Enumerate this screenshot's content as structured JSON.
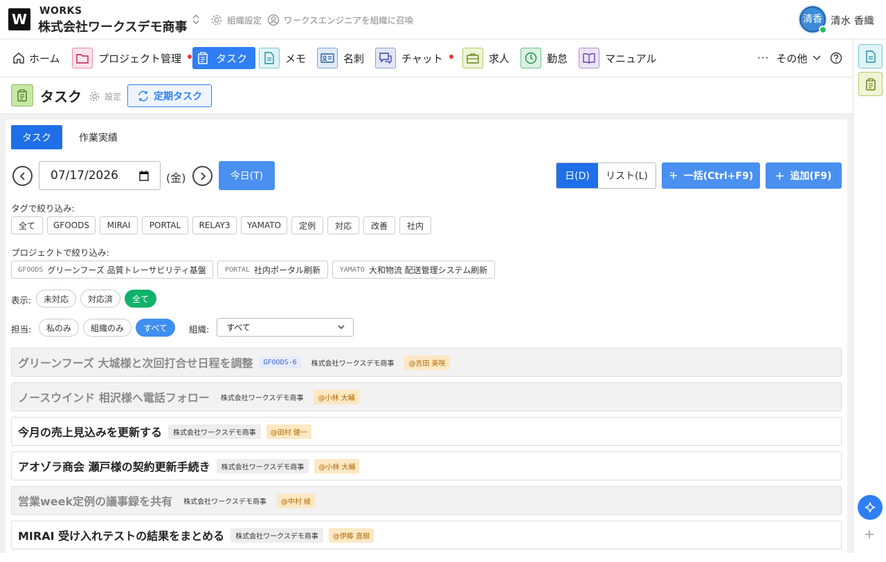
{
  "header": {
    "logo": "W",
    "brand": "WORKS",
    "org_name": "株式会社ワークスデモ商事",
    "org_settings": "組織設定",
    "invite": "ワークスエンジニアを組織に召喚",
    "avatar_text": "清香",
    "user_name": "清水 香織"
  },
  "nav": {
    "items": [
      {
        "label": "ホーム",
        "icon": "home-icon"
      },
      {
        "label": "プロジェクト管理",
        "icon": "folder-icon",
        "dot": true
      },
      {
        "label": "タスク",
        "icon": "clipboard-icon",
        "active": true
      },
      {
        "label": "メモ",
        "icon": "memo-icon"
      },
      {
        "label": "名刺",
        "icon": "business-card-icon"
      },
      {
        "label": "チャット",
        "icon": "chat-icon",
        "dot": true
      },
      {
        "label": "求人",
        "icon": "briefcase-icon"
      },
      {
        "label": "勤怠",
        "icon": "clock-icon"
      },
      {
        "label": "マニュアル",
        "icon": "book-icon"
      }
    ],
    "more": "その他"
  },
  "page": {
    "title": "タスク",
    "settings": "設定",
    "recurring": "定期タスク"
  },
  "tabs": [
    "タスク",
    "作業実績"
  ],
  "toolbar": {
    "date": "07/17/2026",
    "day_of_week": "(金)",
    "today": "今日(T)",
    "view_day": "日(D)",
    "view_list": "リスト(L)",
    "bulk": "一括(Ctrl+F9)",
    "add": "追加(F9)"
  },
  "filters": {
    "tag_label": "タグで絞り込み:",
    "tags": [
      "全て",
      "GFOODS",
      "MIRAI",
      "PORTAL",
      "RELAY3",
      "YAMATO",
      "定例",
      "対応",
      "改善",
      "社内"
    ],
    "project_label": "プロジェクトで絞り込み:",
    "projects": [
      {
        "code": "GFOODS",
        "name": "グリーンフーズ 品質トレーサビリティ基盤"
      },
      {
        "code": "PORTAL",
        "name": "社内ポータル刷新"
      },
      {
        "code": "YAMATO",
        "name": "大和物流 配送管理システム刷新"
      }
    ],
    "display_label": "表示:",
    "display": [
      "未対応",
      "対応済",
      "全て"
    ],
    "assignee_label": "担当:",
    "assignee": [
      "私のみ",
      "組織のみ",
      "すべて"
    ],
    "org_label": "組織:",
    "org_value": "すべて"
  },
  "tasks": [
    {
      "title": "グリーンフーズ 大城様と次回打合せ日程を調整",
      "code": "GFOODS-6",
      "org": "株式会社ワークスデモ商事",
      "assignee": "@吉田 美咲",
      "done": true
    },
    {
      "title": "ノースウインド 相沢様へ電話フォロー",
      "code": "",
      "org": "株式会社ワークスデモ商事",
      "assignee": "@小林 大輔",
      "done": true
    },
    {
      "title": "今月の売上見込みを更新する",
      "code": "",
      "org": "株式会社ワークスデモ商事",
      "assignee": "@田村 健一",
      "done": false
    },
    {
      "title": "アオゾラ商会 瀬戸様の契約更新手続き",
      "code": "",
      "org": "株式会社ワークスデモ商事",
      "assignee": "@小林 大輔",
      "done": false
    },
    {
      "title": "営業week定例の議事録を共有",
      "code": "",
      "org": "株式会社ワークスデモ商事",
      "assignee": "@中村 綾",
      "done": true
    },
    {
      "title": "MIRAI 受け入れテストの結果をまとめる",
      "code": "",
      "org": "株式会社ワークスデモ商事",
      "assignee": "@伊藤 直樹",
      "done": false
    }
  ]
}
